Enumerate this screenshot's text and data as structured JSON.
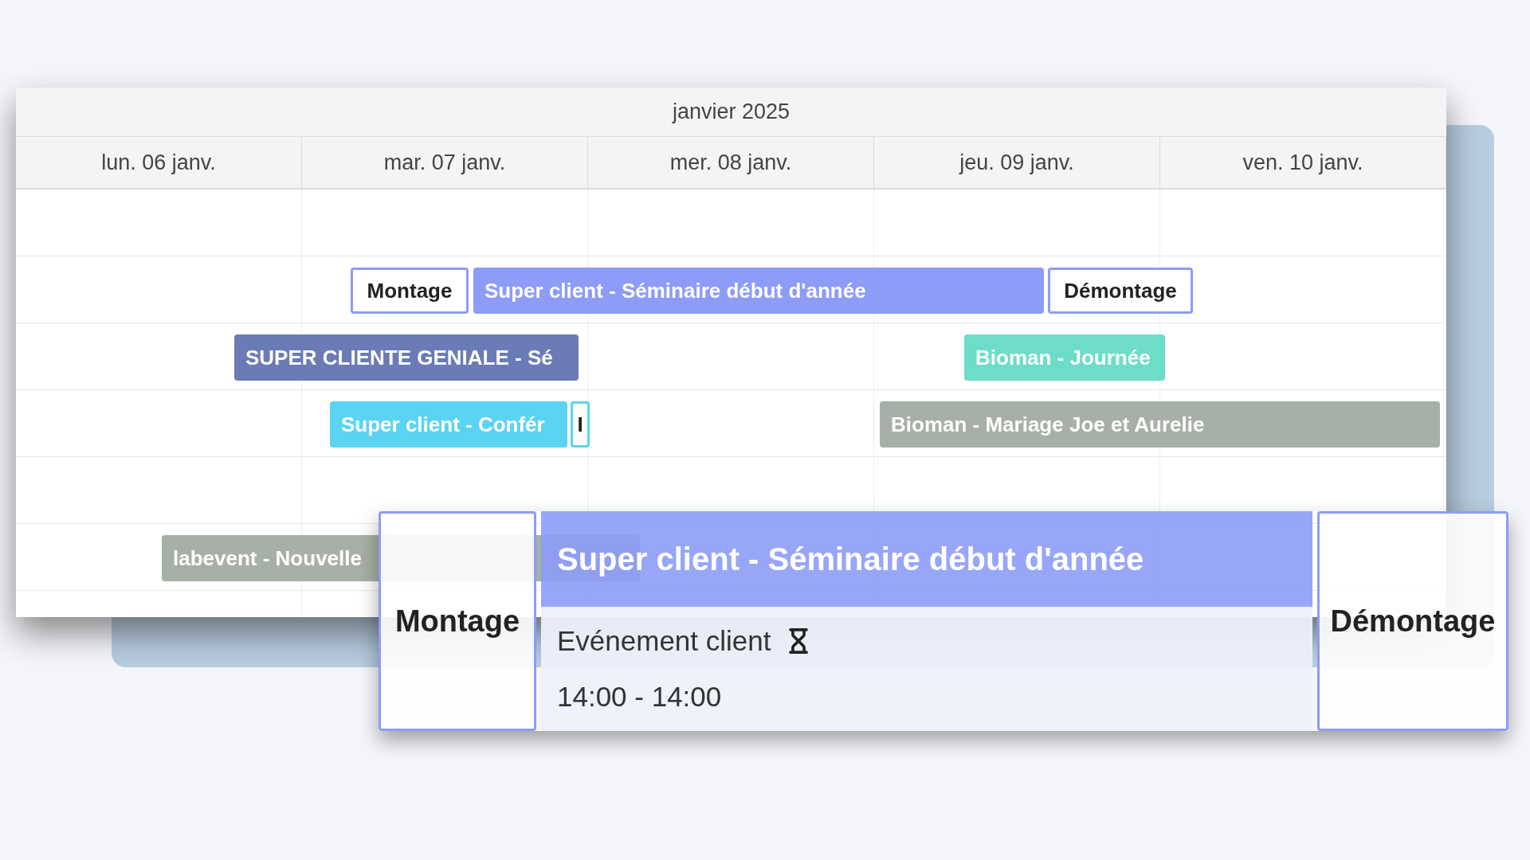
{
  "calendar": {
    "month": "janvier 2025",
    "days": [
      "lun. 06 janv.",
      "mar. 07 janv.",
      "mer. 08 janv.",
      "jeu. 09 janv.",
      "ven. 10 janv."
    ],
    "events": [
      {
        "label": "Montage",
        "kind": "outline",
        "color": "#8d9cf7"
      },
      {
        "label": "Super client - Séminaire début d'année",
        "kind": "filled",
        "color": "#8d9cf7"
      },
      {
        "label": "Démontage",
        "kind": "outline",
        "color": "#8d9cf7"
      },
      {
        "label": "SUPER CLIENTE GENIALE - Sé",
        "kind": "filled",
        "color": "#6a7bb5"
      },
      {
        "label": "Bioman - Journée",
        "kind": "filled",
        "color": "#6ddcc8"
      },
      {
        "label": "Super client - Confér",
        "kind": "filled",
        "color": "#5bd3f5"
      },
      {
        "label": "I",
        "kind": "outline",
        "color": "#5bd3f5"
      },
      {
        "label": "Bioman - Mariage Joe et Aurelie",
        "kind": "filled",
        "color": "#a7b0a6"
      },
      {
        "label": "labevent - Nouvelle",
        "kind": "filled",
        "color": "#a7b0a6"
      }
    ]
  },
  "popup": {
    "before": "Montage",
    "title": "Super client - Séminaire début d'année",
    "subtitle": "Evénement client",
    "time": "14:00 - 14:00",
    "after": "Démontage"
  }
}
